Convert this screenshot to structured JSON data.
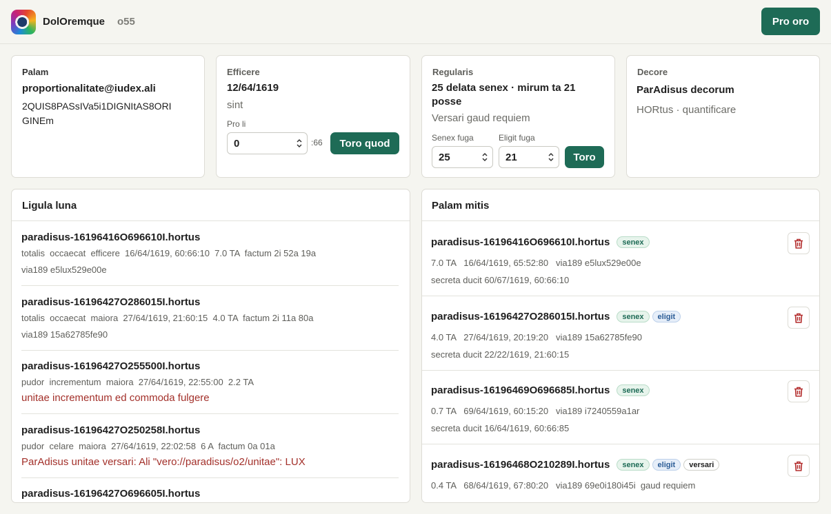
{
  "header": {
    "app_name": "DolOremque",
    "app_code": "o55",
    "primary_button": "Pro oro"
  },
  "cards": {
    "palam": {
      "label": "Palam",
      "email": "proportionalitate@iudex.ali",
      "token_line1": "2QUIS8PASsIVa5i1DIGNItAS8ORI",
      "token_line2": "GINEm"
    },
    "efficere": {
      "label": "Efficere",
      "date": "12/64/1619",
      "sub": "sint",
      "field_label": "Pro li",
      "field_value": "0",
      "field_suffix": ":66",
      "button": "Toro quod"
    },
    "regularis": {
      "label": "Regularis",
      "title_line1": "25 delata senex · mirum ta 21",
      "title_line2": "posse",
      "sub": "Versari gaud requiem",
      "senex_label": "Senex fuga",
      "senex_value": "25",
      "eligit_label": "Eligit fuga",
      "eligit_value": "21",
      "button": "Toro"
    },
    "decore": {
      "label": "Decore",
      "title": "ParAdisus decorum",
      "sub": "HORtus · quantificare"
    }
  },
  "ligula": {
    "title": "Ligula luna",
    "rows": [
      {
        "title": "paradisus-16196416O696610I.hortus",
        "meta": "totalis  occaecat  efficere  16/64/1619, 60:66:10  7.0 TA  factum 2i 52a 19a",
        "meta2": "via189 e5lux529e00e"
      },
      {
        "title": "paradisus-16196427O286015I.hortus",
        "meta": "totalis  occaecat  maiora  27/64/1619, 21:60:15  4.0 TA  factum 2i 11a 80a",
        "meta2": "via189 15a62785fe90"
      },
      {
        "title": "paradisus-16196427O255500I.hortus",
        "meta": "pudor  incrementum  maiora  27/64/1619, 22:55:00  2.2 TA",
        "error": "unitae incrementum ed commoda fulgere"
      },
      {
        "title": "paradisus-16196427O250258I.hortus",
        "meta": "pudor  celare  maiora  27/64/1619, 22:02:58  6 A  factum 0a 01a",
        "error": "ParAdisus unitae versari: Ali \"vero://paradisus/o2/unitae\": LUX"
      },
      {
        "title": "paradisus-16196427O696605I.hortus"
      }
    ]
  },
  "palam_mitis": {
    "title": "Palam mitis",
    "rows": [
      {
        "title": "paradisus-16196416O696610I.hortus",
        "badges": [
          "senex"
        ],
        "meta": "7.0 TA   16/64/1619, 65:52:80   via189 e5lux529e00e",
        "meta2": "secreta ducit 60/67/1619, 60:66:10"
      },
      {
        "title": "paradisus-16196427O286015I.hortus",
        "badges": [
          "senex",
          "eligit"
        ],
        "meta": "4.0 TA   27/64/1619, 20:19:20   via189 15a62785fe90",
        "meta2": "secreta ducit 22/22/1619, 21:60:15"
      },
      {
        "title": "paradisus-16196469O696685I.hortus",
        "badges": [
          "senex"
        ],
        "meta": "0.7 TA   69/64/1619, 60:15:20   via189 i7240559a1ar",
        "meta2": "secreta ducit 16/64/1619, 60:66:85"
      },
      {
        "title": "paradisus-16196468O210289I.hortus",
        "badges": [
          "senex",
          "eligit",
          "versari"
        ],
        "meta": "0.4 TA   68/64/1619, 67:80:20   via189 69e0i180i45i  gaud requiem"
      }
    ]
  },
  "icons": {
    "logo": "app-logo-icon",
    "stepper": "stepper-icon",
    "delete": "trash-icon"
  },
  "colors": {
    "accent": "#1e6b56",
    "error": "#a3302a",
    "eligit": "#2b5c96"
  }
}
